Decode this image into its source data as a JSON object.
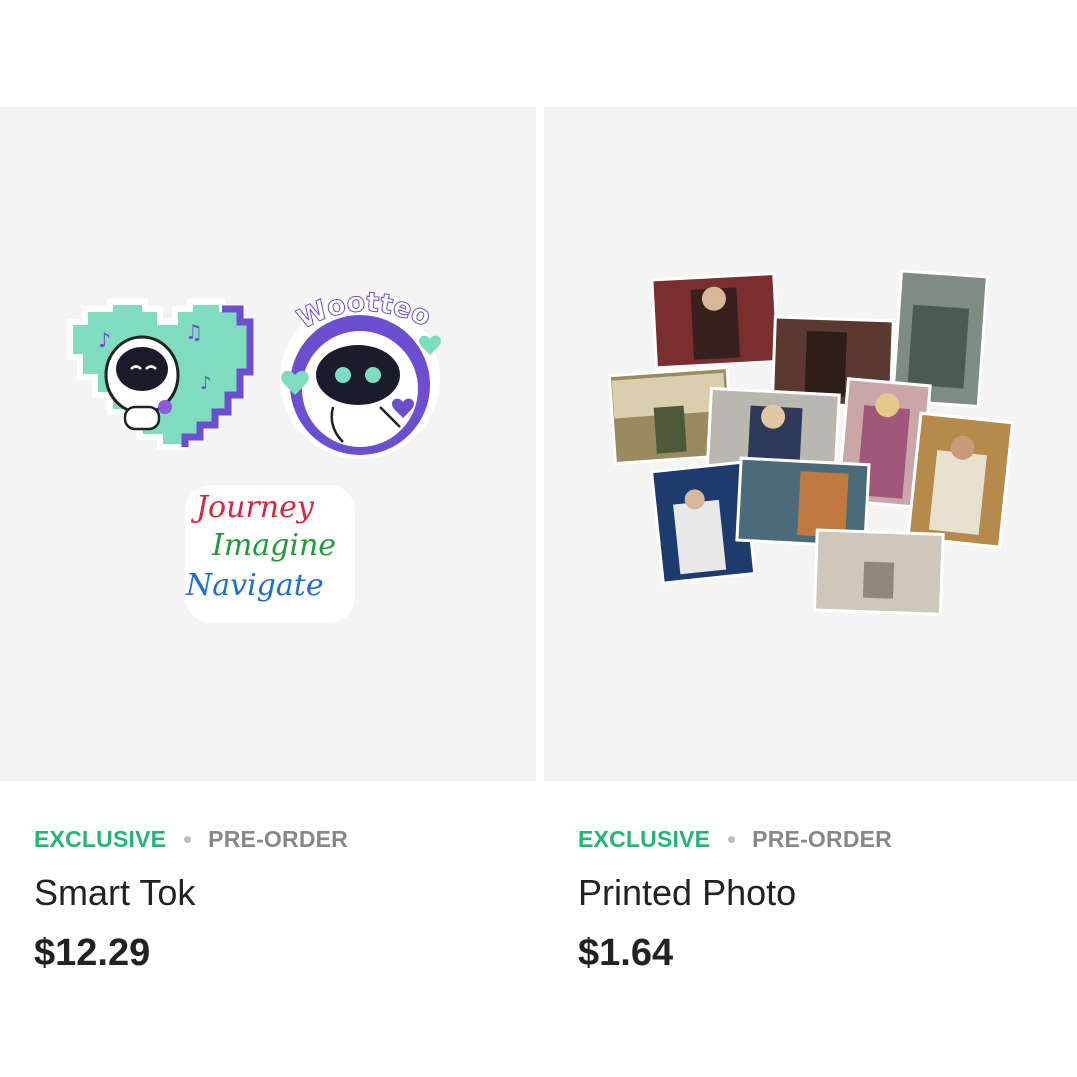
{
  "products": [
    {
      "tag_exclusive": "EXCLUSIVE",
      "tag_preorder": "PRE-ORDER",
      "name": "Smart Tok",
      "price": "$12.29",
      "image": {
        "sticker_text_badge": "Wootteo",
        "script_lines": [
          "Journey",
          "Imagine",
          "Navigate"
        ]
      }
    },
    {
      "tag_exclusive": "EXCLUSIVE",
      "tag_preorder": "PRE-ORDER",
      "name": "Printed Photo",
      "price": "$1.64"
    }
  ],
  "colors": {
    "exclusive": "#22b573",
    "preorder": "#888888",
    "text": "#222222",
    "thumb_bg": "#f4f4f4"
  }
}
